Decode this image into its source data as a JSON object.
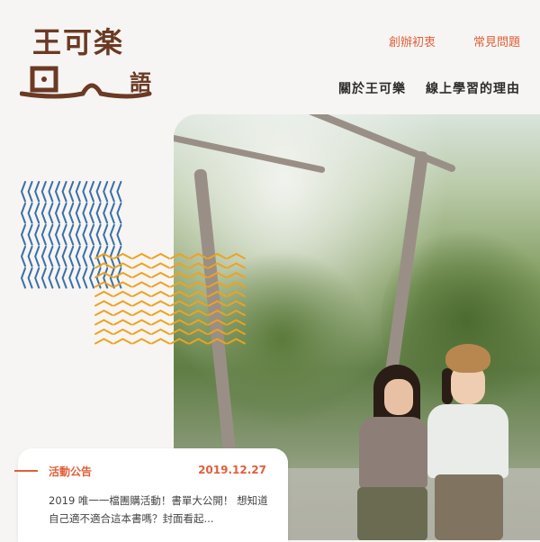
{
  "logo": {
    "chars": "王可楽",
    "small_right": "語"
  },
  "nav_top": [
    "創辦初衷",
    "常見問題"
  ],
  "nav_main": [
    "關於王可樂",
    "線上學習的理由"
  ],
  "notice": {
    "title": "活動公告",
    "date": "2019.12.27",
    "body": "2019 唯一一檔團購活動！書單大公開！ 想知道自己適不適合這本書嗎？封面看起..."
  },
  "colors": {
    "accent": "#e0603a",
    "brand_brown": "#6b3a24",
    "pattern_blue": "#3a6fa8",
    "pattern_orange": "#f0a21c"
  }
}
